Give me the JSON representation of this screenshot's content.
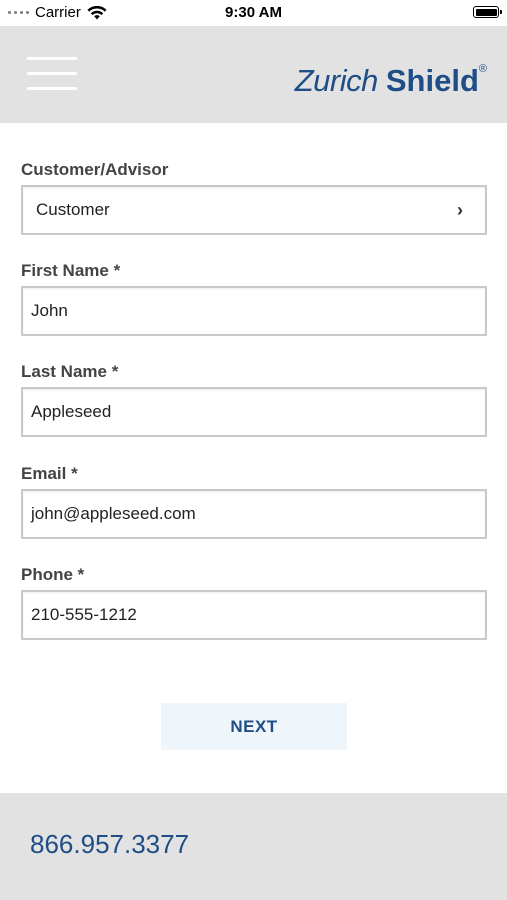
{
  "status_bar": {
    "carrier": "Carrier",
    "time": "9:30 AM"
  },
  "header": {
    "logo_zurich": "Zurich",
    "logo_shield": "Shield",
    "logo_registered": "®"
  },
  "form": {
    "customer_advisor": {
      "label": "Customer/Advisor",
      "value": "Customer"
    },
    "first_name": {
      "label": "First Name *",
      "value": "John"
    },
    "last_name": {
      "label": "Last Name *",
      "value": "Appleseed"
    },
    "email": {
      "label": "Email *",
      "value": "john@appleseed.com"
    },
    "phone": {
      "label": "Phone *",
      "value": "210-555-1212"
    }
  },
  "next_button": {
    "label": "NEXT"
  },
  "footer": {
    "phone": "866.957.3377"
  },
  "colors": {
    "brand_blue": "#1f4e87",
    "header_bg": "#e2e2e2",
    "button_bg": "#eef5fb"
  },
  "icons": [
    "menu-icon",
    "wifi-icon",
    "battery-icon",
    "chevron-right-icon"
  ]
}
